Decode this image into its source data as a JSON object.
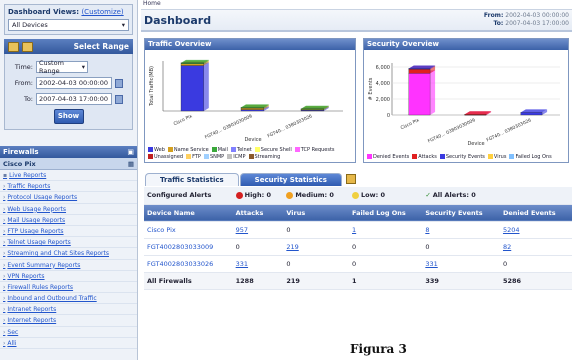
{
  "sidebar": {
    "dash_views_label": "Dashboard Views:",
    "dash_views_link": "(Customize)",
    "device_select": "All Devices",
    "range": {
      "title": "Select Range",
      "time_label": "Time:",
      "time_value": "Custom Range",
      "from_label": "From:",
      "from_value": "2002-04-03 00:00:00",
      "to_label": "To:",
      "to_value": "2007-04-03 17:00:00",
      "show_button": "Show"
    },
    "firewalls_title": "Firewalls",
    "device": "Cisco Pix",
    "items": [
      "Live Reports",
      "Traffic Reports",
      "Protocol Usage Reports",
      "Web Usage Reports",
      "Mail Usage Reports",
      "FTP Usage Reports",
      "Telnet Usage Reports",
      "Streaming and Chat Sites Reports",
      "Event Summary Reports",
      "VPN Reports",
      "Firewall Rules Reports",
      "Inbound and Outbound Traffic",
      "Intranet Reports",
      "Internet Reports",
      "Sec",
      "Alli"
    ]
  },
  "main": {
    "breadcrumb": "Home",
    "title": "Dashboard",
    "from_label": "From:",
    "from_value": "2002-04-03 00:00:00",
    "to_label": "To:",
    "to_value": "2007-04-03 17:00:00"
  },
  "traffic_panel": {
    "title": "Traffic Overview",
    "legend": [
      {
        "name": "Web",
        "color": "#3a3ae0"
      },
      {
        "name": "Name Service",
        "color": "#d4a020"
      },
      {
        "name": "Mail",
        "color": "#3aa83a"
      },
      {
        "name": "Telnet",
        "color": "#8080ff"
      },
      {
        "name": "Secure Shell",
        "color": "#ffff66"
      },
      {
        "name": "TCP Requests",
        "color": "#ff66ff"
      },
      {
        "name": "Unassigned",
        "color": "#c02020"
      },
      {
        "name": "FTP",
        "color": "#ffd060"
      },
      {
        "name": "SNMP",
        "color": "#a0d0ff"
      },
      {
        "name": "ICMP",
        "color": "#c0c0c0"
      },
      {
        "name": "Streaming",
        "color": "#8a5a2a"
      }
    ]
  },
  "security_panel": {
    "title": "Security Overview",
    "legend": [
      {
        "name": "Denied Events",
        "color": "#ff33ff"
      },
      {
        "name": "Attacks",
        "color": "#e02020"
      },
      {
        "name": "Security Events",
        "color": "#3a3ae0"
      },
      {
        "name": "Virus",
        "color": "#ffd040"
      },
      {
        "name": "Failed Log Ons",
        "color": "#80c0ff"
      }
    ]
  },
  "chart_data": [
    {
      "type": "bar",
      "title": "Traffic Overview",
      "ylabel": "Total Traffic(MB)",
      "xlabel": "Device",
      "categories": [
        "Cisco Pix",
        "FGT40... 03803030009",
        "FGT40... 0380303026"
      ],
      "series": [
        {
          "name": "Web",
          "values": [
            100,
            3,
            2
          ]
        },
        {
          "name": "Name Service",
          "values": [
            4,
            4,
            2
          ]
        },
        {
          "name": "Mail",
          "values": [
            2,
            1,
            1
          ]
        }
      ],
      "ylim": [
        0,
        110
      ]
    },
    {
      "type": "bar",
      "title": "Security Overview",
      "ylabel": "# Events",
      "xlabel": "Device",
      "yticks": [
        "0",
        "2,000",
        "4,000",
        "6,000"
      ],
      "categories": [
        "Cisco Pix",
        "FGT40... 03803030009",
        "FGT40... 0380303026"
      ],
      "series": [
        {
          "name": "Denied Events",
          "values": [
            5204,
            82,
            0
          ]
        },
        {
          "name": "Attacks",
          "values": [
            600,
            10,
            0
          ]
        },
        {
          "name": "Security Events",
          "values": [
            8,
            0,
            331
          ]
        }
      ],
      "ylim": [
        0,
        6500
      ]
    }
  ],
  "tabs": {
    "traffic": "Traffic Statistics",
    "security": "Security Statistics"
  },
  "alerts": {
    "label": "Configured Alerts",
    "high": "High: 0",
    "medium": "Medium: 0",
    "low": "Low: 0",
    "all": "All Alerts: 0"
  },
  "table": {
    "headers": [
      "Device Name",
      "Attacks",
      "Virus",
      "Failed Log Ons",
      "Security Events",
      "Denied Events"
    ],
    "rows": [
      [
        "Cisco Pix",
        "957",
        "0",
        "1",
        "8",
        "5204"
      ],
      [
        "FGT4002803033009",
        "0",
        "219",
        "0",
        "0",
        "82"
      ],
      [
        "FGT4002803033026",
        "331",
        "0",
        "0",
        "331",
        "0"
      ]
    ],
    "total": [
      "All Firewalls",
      "1288",
      "219",
      "1",
      "339",
      "5286"
    ]
  },
  "caption": "Figura 3"
}
